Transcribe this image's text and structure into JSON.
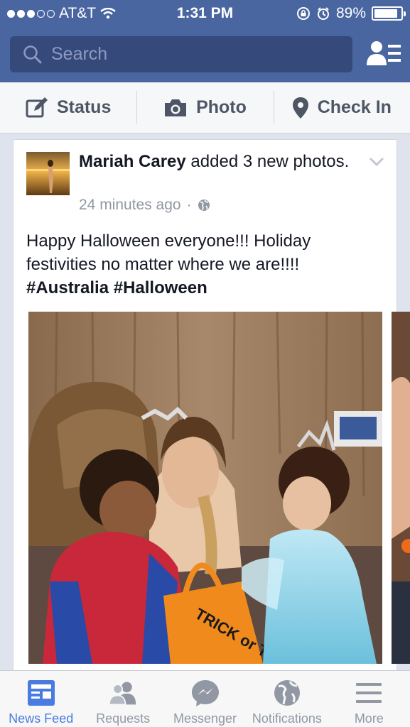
{
  "status_bar": {
    "carrier": "AT&T",
    "time": "1:31 PM",
    "battery": "89%",
    "battery_level": 0.89,
    "signal_bars": 3,
    "signal_total": 5
  },
  "header": {
    "search_placeholder": "Search",
    "background_color": "#4a66a0"
  },
  "composer": {
    "items": [
      {
        "label": "Status",
        "icon": "edit-icon"
      },
      {
        "label": "Photo",
        "icon": "camera-icon"
      },
      {
        "label": "Check In",
        "icon": "location-pin-icon"
      }
    ]
  },
  "post": {
    "author": "Mariah Carey",
    "action": "added 3 new photos.",
    "time": "24 minutes ago",
    "privacy_icon": "globe-icon",
    "text": "Happy Halloween everyone!!! Holiday festivities no matter where we are!!!!",
    "hashtags": "#Australia #Halloween",
    "photo_bag_text": "TRICK or TREAT"
  },
  "tabbar": {
    "tabs": [
      {
        "label": "News Feed",
        "icon": "news-feed-icon",
        "active": true
      },
      {
        "label": "Requests",
        "icon": "friend-requests-icon",
        "active": false
      },
      {
        "label": "Messenger",
        "icon": "messenger-icon",
        "active": false
      },
      {
        "label": "Notifications",
        "icon": "globe-icon",
        "active": false
      },
      {
        "label": "More",
        "icon": "menu-icon",
        "active": false
      }
    ],
    "active_color": "#4a7be0",
    "inactive_color": "#9197a3"
  }
}
